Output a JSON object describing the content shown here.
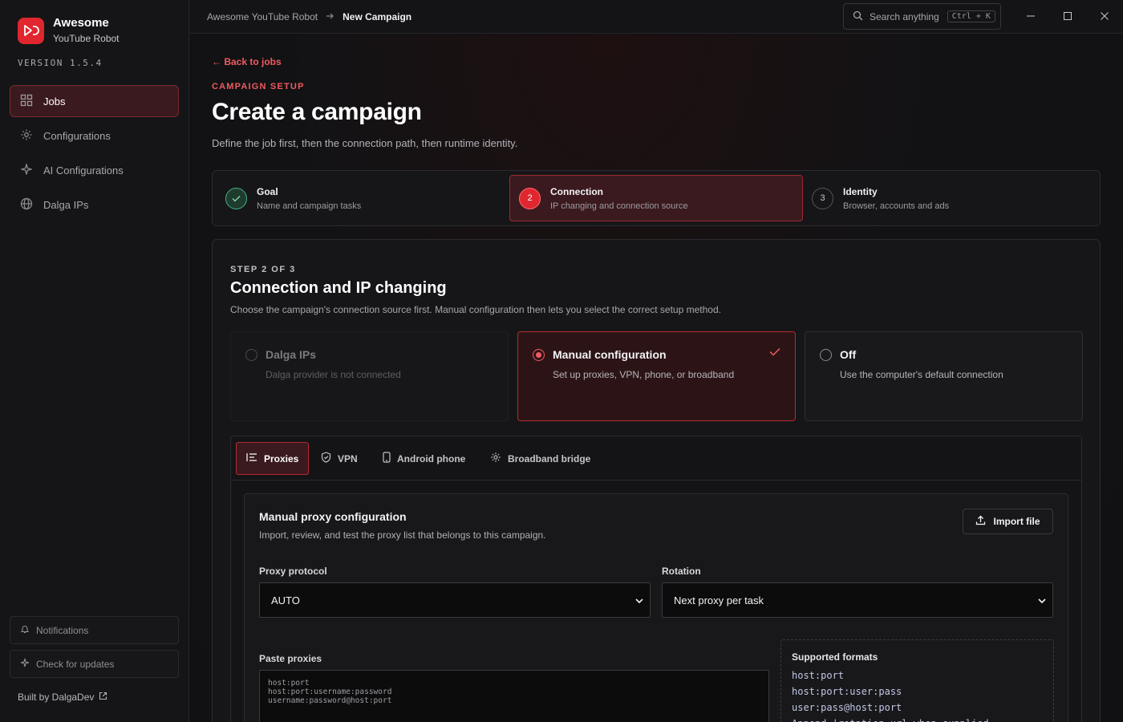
{
  "app": {
    "name": "Awesome",
    "subtitle": "YouTube Robot",
    "version": "VERSION 1.5.4"
  },
  "sidebar": {
    "items": [
      {
        "label": "Jobs",
        "icon": "grid-icon",
        "active": true
      },
      {
        "label": "Configurations",
        "icon": "gear-icon"
      },
      {
        "label": "AI Configurations",
        "icon": "sparkle-icon"
      },
      {
        "label": "Dalga IPs",
        "icon": "globe-icon"
      }
    ],
    "notifications": "Notifications",
    "check_updates": "Check for updates",
    "built_by": "Built by DalgaDev"
  },
  "topbar": {
    "breadcrumb_root": "Awesome YouTube Robot",
    "breadcrumb_current": "New Campaign",
    "search_placeholder": "Search anything",
    "search_shortcut": "Ctrl + K"
  },
  "page": {
    "back": "← Back to jobs",
    "eyebrow": "CAMPAIGN SETUP",
    "title": "Create a campaign",
    "subtitle": "Define the job first, then the connection path, then runtime identity."
  },
  "steps": [
    {
      "title": "Goal",
      "desc": "Name and campaign tasks",
      "state": "done",
      "number": ""
    },
    {
      "title": "Connection",
      "desc": "IP changing and connection source",
      "state": "active",
      "number": "2"
    },
    {
      "title": "Identity",
      "desc": "Browser, accounts and ads",
      "state": "pending",
      "number": "3"
    }
  ],
  "panel": {
    "step_of": "STEP 2 OF 3",
    "title": "Connection and IP changing",
    "desc": "Choose the campaign's connection source first. Manual configuration then lets you select the correct setup method."
  },
  "options": [
    {
      "title": "Dalga IPs",
      "desc": "Dalga provider is not connected",
      "state": "disabled"
    },
    {
      "title": "Manual configuration",
      "desc": "Set up proxies, VPN, phone, or broadband",
      "state": "selected"
    },
    {
      "title": "Off",
      "desc": "Use the computer's default connection",
      "state": "idle"
    }
  ],
  "tabs": [
    {
      "label": "Proxies",
      "icon": "list-icon",
      "active": true
    },
    {
      "label": "VPN",
      "icon": "shield-check-icon"
    },
    {
      "label": "Android phone",
      "icon": "phone-icon"
    },
    {
      "label": "Broadband bridge",
      "icon": "gear-icon"
    }
  ],
  "proxy": {
    "title": "Manual proxy configuration",
    "desc": "Import, review, and test the proxy list that belongs to this campaign.",
    "import_label": "Import file",
    "protocol_label": "Proxy protocol",
    "protocol_value": "AUTO",
    "rotation_label": "Rotation",
    "rotation_value": "Next proxy per task",
    "paste_label": "Paste proxies",
    "paste_placeholder": "host:port\nhost:port:username:password\nusername:password@host:port",
    "formats_title": "Supported formats",
    "formats": [
      "host:port",
      "host:port:user:pass",
      "user:pass@host:port",
      "Append |rotation-url when supplied"
    ]
  },
  "colors": {
    "accent": "#e0262e",
    "accent_text": "#f05a5f",
    "success": "#3fb27f",
    "background": "#111113"
  }
}
